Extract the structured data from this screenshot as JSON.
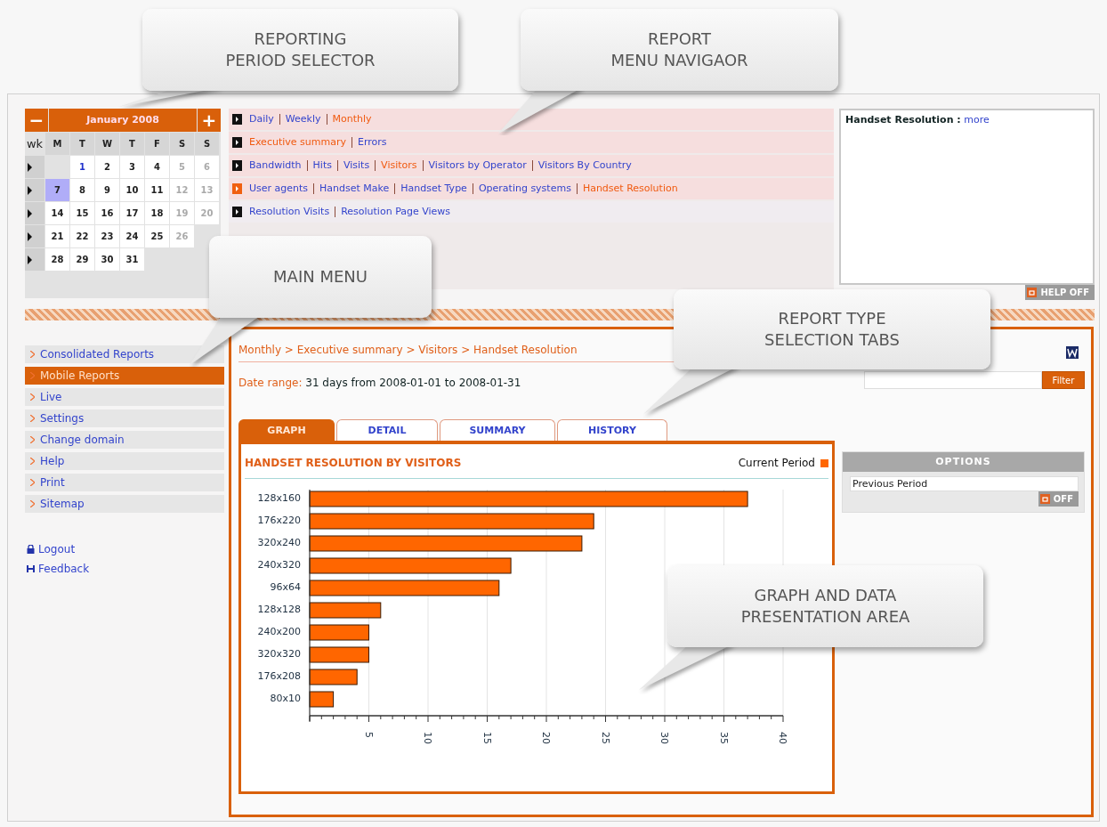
{
  "calendar": {
    "month": "January 2008",
    "prev": "−",
    "next": "+",
    "headers": [
      "wk",
      "M",
      "T",
      "W",
      "T",
      "F",
      "S",
      "S"
    ],
    "weeks": [
      {
        "days": [
          {
            "kind": "blank"
          },
          {
            "label": "1",
            "kind": "today",
            "selected": false
          },
          {
            "label": "2",
            "kind": "weekday",
            "selected": false
          },
          {
            "label": "3",
            "kind": "weekday",
            "selected": false
          },
          {
            "label": "4",
            "kind": "weekday",
            "selected": false
          },
          {
            "label": "5",
            "kind": "weekend",
            "selected": false
          },
          {
            "label": "6",
            "kind": "weekend",
            "selected": false
          }
        ]
      },
      {
        "days": [
          {
            "label": "7",
            "kind": "weekday",
            "selected": true
          },
          {
            "label": "8",
            "kind": "weekday",
            "selected": false
          },
          {
            "label": "9",
            "kind": "weekday",
            "selected": false
          },
          {
            "label": "10",
            "kind": "weekday",
            "selected": false
          },
          {
            "label": "11",
            "kind": "weekday",
            "selected": false
          },
          {
            "label": "12",
            "kind": "weekend",
            "selected": false
          },
          {
            "label": "13",
            "kind": "weekend",
            "selected": false
          }
        ]
      },
      {
        "days": [
          {
            "label": "14",
            "kind": "weekday",
            "selected": false
          },
          {
            "label": "15",
            "kind": "weekday",
            "selected": false
          },
          {
            "label": "16",
            "kind": "weekday",
            "selected": false
          },
          {
            "label": "17",
            "kind": "weekday",
            "selected": false
          },
          {
            "label": "18",
            "kind": "weekday",
            "selected": false
          },
          {
            "label": "19",
            "kind": "weekend",
            "selected": false
          },
          {
            "label": "20",
            "kind": "weekend",
            "selected": false
          }
        ]
      },
      {
        "days": [
          {
            "label": "21",
            "kind": "weekday",
            "selected": false
          },
          {
            "label": "22",
            "kind": "weekday",
            "selected": false
          },
          {
            "label": "23",
            "kind": "weekday",
            "selected": false
          },
          {
            "label": "24",
            "kind": "weekday",
            "selected": false
          },
          {
            "label": "25",
            "kind": "weekday",
            "selected": false
          },
          {
            "label": "26",
            "kind": "weekend",
            "selected": false
          }
        ]
      },
      {
        "days": [
          {
            "label": "28",
            "kind": "weekday",
            "selected": false
          },
          {
            "label": "29",
            "kind": "weekday",
            "selected": false
          },
          {
            "label": "30",
            "kind": "weekday",
            "selected": false
          },
          {
            "label": "31",
            "kind": "weekday",
            "selected": false
          }
        ]
      }
    ]
  },
  "report_menu": [
    {
      "active": false,
      "links": [
        {
          "label": "Daily",
          "selected": false
        },
        {
          "label": "Weekly",
          "selected": false
        },
        {
          "label": "Monthly",
          "selected": true
        }
      ]
    },
    {
      "active": false,
      "links": [
        {
          "label": "Executive summary",
          "selected": true
        },
        {
          "label": "Errors",
          "selected": false
        }
      ]
    },
    {
      "active": false,
      "links": [
        {
          "label": "Bandwidth",
          "selected": false
        },
        {
          "label": "Hits",
          "selected": false
        },
        {
          "label": "Visits",
          "selected": false
        },
        {
          "label": "Visitors",
          "selected": true
        },
        {
          "label": "Visitors by Operator",
          "selected": false
        },
        {
          "label": "Visitors By Country",
          "selected": false
        }
      ]
    },
    {
      "active": true,
      "links": [
        {
          "label": "User agents",
          "selected": false
        },
        {
          "label": "Handset Make",
          "selected": false
        },
        {
          "label": "Handset Type",
          "selected": false
        },
        {
          "label": "Operating systems",
          "selected": false
        },
        {
          "label": "Handset Resolution",
          "selected": true
        }
      ]
    },
    {
      "active": false,
      "links": [
        {
          "label": "Resolution Visits",
          "selected": false
        },
        {
          "label": "Resolution Page Views",
          "selected": false
        }
      ]
    }
  ],
  "help": {
    "title": "Handset Resolution :",
    "link": "more",
    "toggle": {
      "label": "HELP OFF",
      "on": false
    }
  },
  "sidebar": {
    "items": [
      {
        "label": "Consolidated Reports",
        "selected": false
      },
      {
        "label": "Mobile Reports",
        "selected": true
      },
      {
        "label": "Live",
        "selected": false
      },
      {
        "label": "Settings",
        "selected": false
      },
      {
        "label": "Change domain",
        "selected": false
      },
      {
        "label": "Help",
        "selected": false
      },
      {
        "label": "Print",
        "selected": false
      },
      {
        "label": "Sitemap",
        "selected": false
      }
    ],
    "links": [
      {
        "label": "Logout",
        "kind": "lock"
      },
      {
        "label": "Feedback",
        "kind": "feedback"
      }
    ]
  },
  "breadcrumb": "Monthly > Executive summary > Visitors > Handset Resolution",
  "date_range": {
    "label": "Date range:",
    "value": "31 days from 2008-01-01 to 2008-01-31"
  },
  "filter": {
    "button": "Filter"
  },
  "tabs": [
    {
      "label": "GRAPH",
      "selected": true
    },
    {
      "label": "DETAIL",
      "selected": false
    },
    {
      "label": "SUMMARY",
      "selected": false
    },
    {
      "label": "HISTORY",
      "selected": false
    }
  ],
  "chart_data": {
    "type": "bar",
    "orientation": "horizontal",
    "title": "HANDSET RESOLUTION BY VISITORS",
    "categories": [
      "128x160",
      "176x220",
      "320x240",
      "240x320",
      "96x64",
      "128x128",
      "240x200",
      "320x320",
      "176x208",
      "80x10"
    ],
    "series": [
      {
        "name": "Current Period",
        "color": "#ff6600",
        "values": [
          37,
          24,
          23,
          17,
          16,
          6,
          5,
          5,
          4,
          2
        ]
      }
    ],
    "xlim": [
      0,
      40
    ],
    "grid": true,
    "xticks": [
      5,
      10,
      15,
      20,
      25,
      30,
      35,
      40
    ]
  },
  "options": {
    "title": "OPTIONS",
    "items": [
      {
        "label": "Previous Period",
        "toggle": {
          "label": "OFF",
          "on": false
        }
      }
    ]
  },
  "callouts": [
    {
      "text": "REPORTING\nPERIOD SELECTOR"
    },
    {
      "text": "REPORT\nMENU NAVIGAOR"
    },
    {
      "text": "MAIN MENU"
    },
    {
      "text": "REPORT TYPE\nSELECTION TABS"
    },
    {
      "text": "GRAPH AND DATA\nPRESENTATION AREA"
    }
  ]
}
